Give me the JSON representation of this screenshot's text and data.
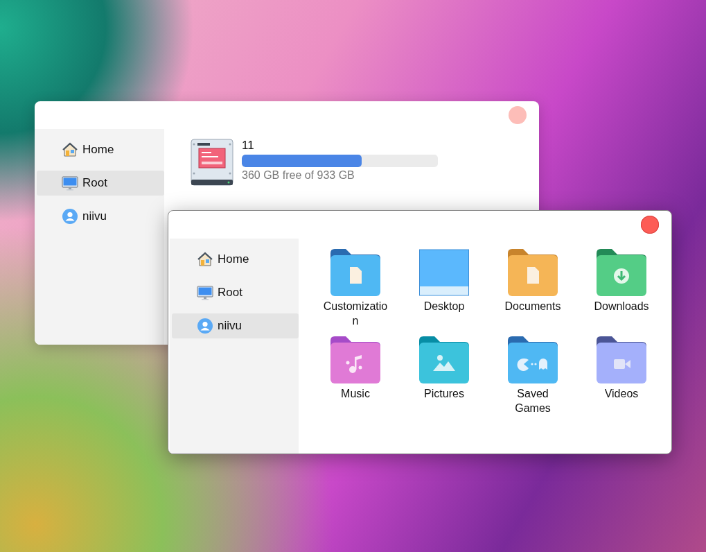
{
  "windows": [
    {
      "active": false,
      "sidebar": {
        "items": [
          {
            "kind": "home",
            "label": "Home",
            "selected": false
          },
          {
            "kind": "computer",
            "label": "Root",
            "selected": true
          },
          {
            "kind": "user",
            "label": "niivu",
            "selected": false
          }
        ]
      },
      "drive": {
        "name": "11",
        "level": 0.61,
        "caption": "360 GB free of 933 GB"
      }
    },
    {
      "active": true,
      "sidebar": {
        "items": [
          {
            "kind": "home",
            "label": "Home",
            "selected": false
          },
          {
            "kind": "computer",
            "label": "Root",
            "selected": false
          },
          {
            "kind": "user",
            "label": "niivu",
            "selected": true
          }
        ]
      },
      "folders": [
        {
          "kind": "customization",
          "label": "Customization",
          "color": "#4fb8f3"
        },
        {
          "kind": "desktop",
          "label": "Desktop",
          "color": "#5bb8fd"
        },
        {
          "kind": "documents",
          "label": "Documents",
          "color": "#f5b556"
        },
        {
          "kind": "downloads",
          "label": "Downloads",
          "color": "#54cd86"
        },
        {
          "kind": "music",
          "label": "Music",
          "color": "#e07ad6"
        },
        {
          "kind": "pictures",
          "label": "Pictures",
          "color": "#3cc3dc"
        },
        {
          "kind": "games",
          "label": "Saved Games",
          "color": "#4fb8f3"
        },
        {
          "kind": "videos",
          "label": "Videos",
          "color": "#a4b0fb"
        }
      ]
    }
  ]
}
